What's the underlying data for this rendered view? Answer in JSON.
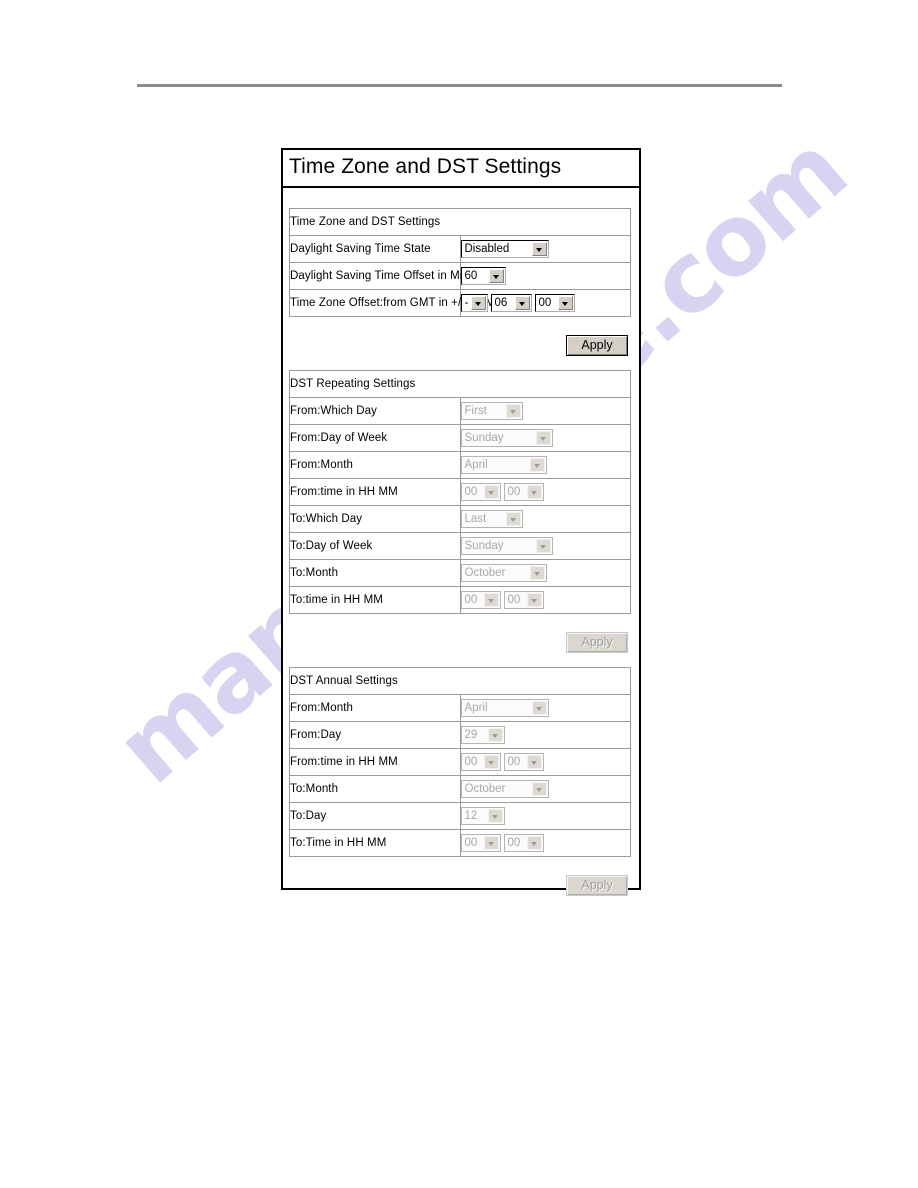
{
  "page": {
    "watermark_text": "manualshive.com"
  },
  "panel": {
    "title": "Time Zone and DST Settings"
  },
  "timezone_table": {
    "section_title": "Time Zone and DST Settings",
    "rows": [
      {
        "label": "Daylight Saving Time State",
        "fields": [
          {
            "value": "Disabled",
            "disabled": false
          }
        ]
      },
      {
        "label": "Daylight Saving Time Offset in Minutes",
        "fields": [
          {
            "value": "60",
            "disabled": false
          }
        ]
      },
      {
        "label": "Time Zone Offset:from GMT in +/-HH:MM",
        "fields": [
          {
            "value": "-",
            "disabled": false
          },
          {
            "value": "06",
            "disabled": false
          },
          {
            "value": "00",
            "disabled": false
          }
        ]
      }
    ],
    "apply_label": "Apply",
    "apply_disabled": false
  },
  "repeating_table": {
    "section_title": "DST Repeating Settings",
    "rows": [
      {
        "label": "From:Which Day",
        "fields": [
          {
            "value": "First",
            "disabled": true
          }
        ]
      },
      {
        "label": "From:Day of Week",
        "fields": [
          {
            "value": "Sunday",
            "disabled": true
          }
        ]
      },
      {
        "label": "From:Month",
        "fields": [
          {
            "value": "April",
            "disabled": true
          }
        ]
      },
      {
        "label": "From:time in HH MM",
        "fields": [
          {
            "value": "00",
            "disabled": true
          },
          {
            "value": "00",
            "disabled": true
          }
        ]
      },
      {
        "label": "To:Which Day",
        "fields": [
          {
            "value": "Last",
            "disabled": true
          }
        ]
      },
      {
        "label": "To:Day of Week",
        "fields": [
          {
            "value": "Sunday",
            "disabled": true
          }
        ]
      },
      {
        "label": "To:Month",
        "fields": [
          {
            "value": "October",
            "disabled": true
          }
        ]
      },
      {
        "label": "To:time in HH MM",
        "fields": [
          {
            "value": "00",
            "disabled": true
          },
          {
            "value": "00",
            "disabled": true
          }
        ]
      }
    ],
    "apply_label": "Apply",
    "apply_disabled": true
  },
  "annual_table": {
    "section_title": "DST Annual Settings",
    "rows": [
      {
        "label": "From:Month",
        "fields": [
          {
            "value": "April",
            "disabled": true
          }
        ]
      },
      {
        "label": "From:Day",
        "fields": [
          {
            "value": "29",
            "disabled": true
          }
        ]
      },
      {
        "label": "From:time in HH MM",
        "fields": [
          {
            "value": "00",
            "disabled": true
          },
          {
            "value": "00",
            "disabled": true
          }
        ]
      },
      {
        "label": "To:Month",
        "fields": [
          {
            "value": "October",
            "disabled": true
          }
        ]
      },
      {
        "label": "To:Day",
        "fields": [
          {
            "value": "12",
            "disabled": true
          }
        ]
      },
      {
        "label": "To:Time in HH MM",
        "fields": [
          {
            "value": "00",
            "disabled": true
          },
          {
            "value": "00",
            "disabled": true
          }
        ]
      }
    ],
    "apply_label": "Apply",
    "apply_disabled": true
  },
  "field_widths": {
    "timezone": [
      [
        "w-state"
      ],
      [
        "w-off"
      ],
      [
        "w-sign",
        "w-num",
        "w-num2"
      ]
    ],
    "repeating": [
      [
        "w-which"
      ],
      [
        "w-dow"
      ],
      [
        "w-month"
      ],
      [
        "w-num2",
        "w-num2"
      ],
      [
        "w-which"
      ],
      [
        "w-dow"
      ],
      [
        "w-month"
      ],
      [
        "w-num2",
        "w-num2"
      ]
    ],
    "annual": [
      [
        "w-month3"
      ],
      [
        "w-day"
      ],
      [
        "w-num2",
        "w-num2"
      ],
      [
        "w-month3"
      ],
      [
        "w-day"
      ],
      [
        "w-num2",
        "w-num2"
      ]
    ]
  }
}
